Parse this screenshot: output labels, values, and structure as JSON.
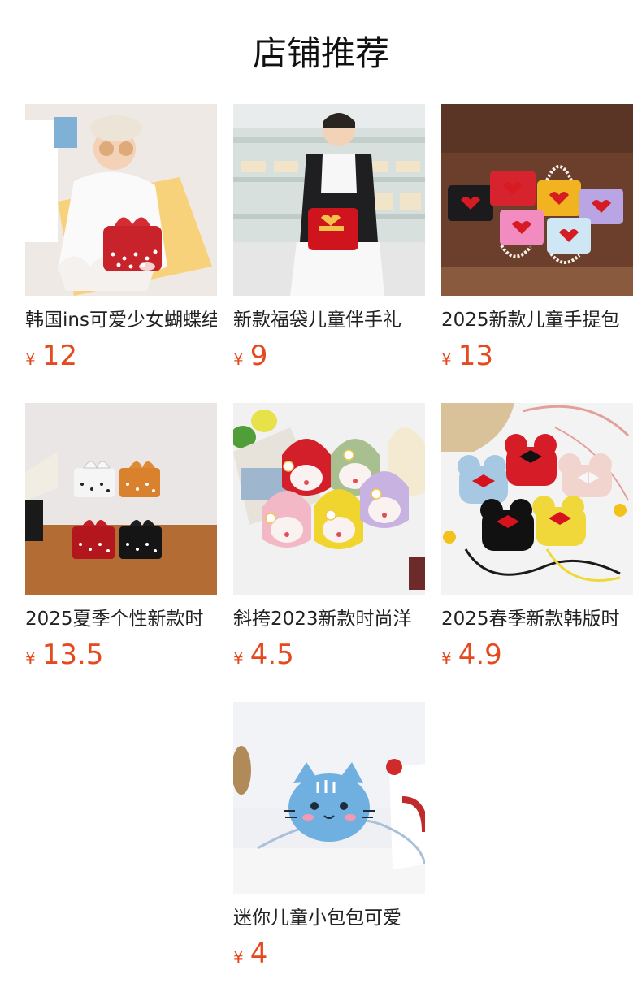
{
  "section": {
    "title": "店铺推荐"
  },
  "currency_symbol": "¥",
  "products": [
    {
      "title": "韩国ins可爱少女蝴蝶结",
      "price": "12"
    },
    {
      "title": "新款福袋儿童伴手礼",
      "price": "9"
    },
    {
      "title": "2025新款儿童手提包",
      "price": "13"
    },
    {
      "title": "2025夏季个性新款时",
      "price": "13.5"
    },
    {
      "title": "斜挎2023新款时尚洋",
      "price": "4.5"
    },
    {
      "title": "2025春季新款韩版时",
      "price": "4.9"
    },
    {
      "title": "迷你儿童小包包可爱",
      "price": "4"
    }
  ]
}
